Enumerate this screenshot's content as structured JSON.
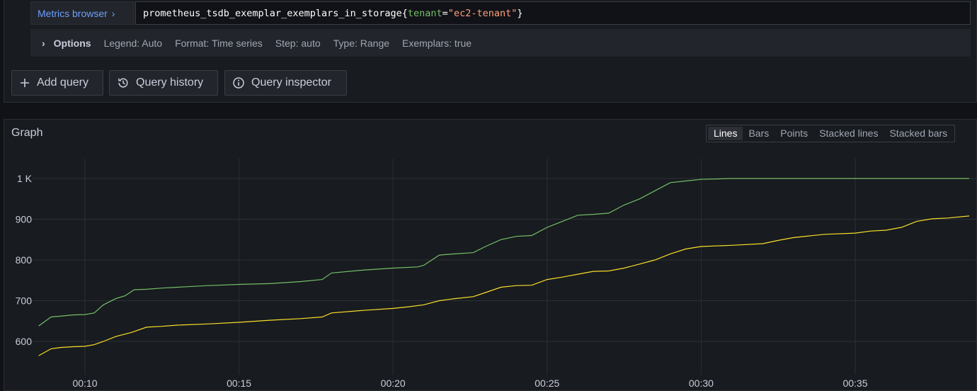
{
  "query": {
    "metrics_browser_label": "Metrics browser",
    "metric_name": "prometheus_tsdb_exemplar_exemplars_in_storage",
    "label_key": "tenant",
    "label_value": "\"ec2-tenant\""
  },
  "options": {
    "title": "Options",
    "legend": "Legend: Auto",
    "format": "Format: Time series",
    "step": "Step: auto",
    "type": "Type: Range",
    "exemplars": "Exemplars: true"
  },
  "actions": {
    "add_query": "Add query",
    "query_history": "Query history",
    "query_inspector": "Query inspector"
  },
  "graph": {
    "title": "Graph",
    "modes": [
      "Lines",
      "Bars",
      "Points",
      "Stacked lines",
      "Stacked bars"
    ],
    "active_mode": "Lines"
  },
  "chart_data": {
    "type": "line",
    "xlabel": "",
    "ylabel": "",
    "y_ticks": [
      "600",
      "700",
      "800",
      "900",
      "1 K"
    ],
    "y_tick_values": [
      600,
      700,
      800,
      900,
      1000
    ],
    "x_ticks": [
      "00:10",
      "00:15",
      "00:20",
      "00:25",
      "00:30",
      "00:35"
    ],
    "x_tick_minutes": [
      10,
      15,
      20,
      25,
      30,
      35
    ],
    "ylim": [
      555,
      1040
    ],
    "xlim_minutes": [
      8.45,
      38.75
    ],
    "grid": true,
    "legend": "none",
    "series": [
      {
        "color": "#73bf69",
        "x_minutes": [
          8.5,
          8.9,
          9.2,
          9.6,
          10.0,
          10.3,
          10.6,
          11.0,
          11.3,
          11.6,
          12.0,
          12.5,
          13.0,
          14.0,
          15.0,
          16.0,
          17.0,
          17.7,
          18.0,
          19.0,
          20.0,
          20.8,
          21.0,
          21.5,
          22.0,
          22.6,
          23.0,
          23.5,
          24.0,
          24.5,
          25.0,
          25.5,
          26.0,
          26.5,
          27.0,
          27.5,
          28.0,
          28.5,
          29.0,
          29.5,
          30.0,
          30.5,
          31.0,
          33.0,
          36.0,
          38.7
        ],
        "values": [
          638,
          660,
          662,
          665,
          666,
          670,
          690,
          705,
          712,
          727,
          728,
          731,
          733,
          737,
          740,
          742,
          747,
          752,
          768,
          775,
          780,
          783,
          787,
          812,
          815,
          818,
          833,
          850,
          858,
          860,
          880,
          895,
          910,
          912,
          915,
          935,
          950,
          970,
          990,
          994,
          998,
          999,
          1000,
          1000,
          1000,
          1000
        ]
      },
      {
        "color": "#fade2a",
        "x_minutes": [
          8.5,
          8.9,
          9.2,
          9.6,
          10.0,
          10.3,
          10.6,
          11.0,
          11.5,
          12.0,
          12.5,
          13.0,
          14.0,
          15.0,
          16.0,
          17.0,
          17.7,
          18.0,
          19.0,
          20.0,
          20.5,
          21.0,
          21.5,
          22.0,
          22.6,
          23.0,
          23.5,
          24.0,
          24.5,
          25.0,
          25.5,
          26.0,
          26.5,
          27.0,
          27.5,
          28.0,
          28.5,
          29.0,
          29.5,
          30.0,
          31.0,
          32.0,
          32.5,
          33.0,
          34.0,
          35.0,
          35.5,
          36.0,
          36.5,
          37.0,
          37.5,
          38.0,
          38.7
        ],
        "values": [
          565,
          582,
          585,
          587,
          588,
          592,
          600,
          612,
          622,
          635,
          637,
          640,
          643,
          647,
          652,
          656,
          660,
          670,
          676,
          681,
          685,
          690,
          700,
          705,
          710,
          720,
          733,
          737,
          738,
          752,
          758,
          765,
          772,
          773,
          780,
          790,
          800,
          815,
          827,
          833,
          836,
          840,
          848,
          855,
          863,
          866,
          871,
          873,
          880,
          895,
          901,
          903,
          908
        ]
      }
    ]
  }
}
